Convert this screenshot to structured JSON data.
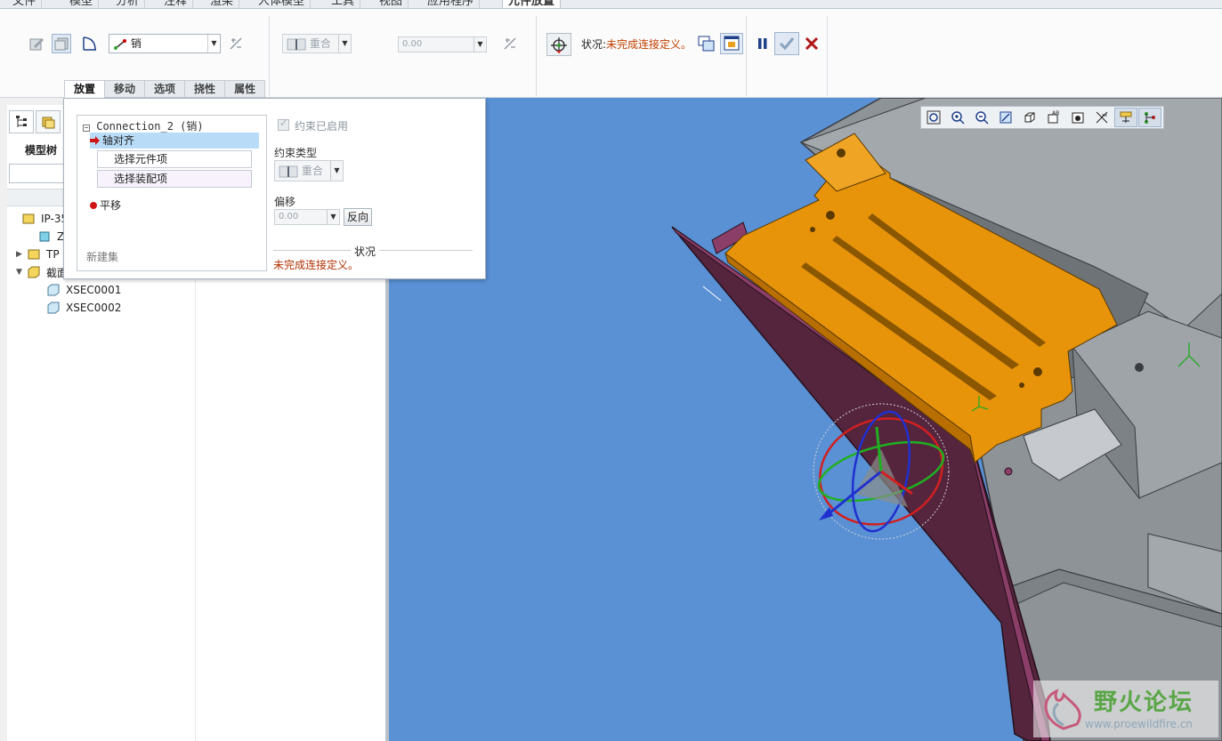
{
  "menubar": {
    "tabs": [
      "文件",
      "模型",
      "分析",
      "注释",
      "渲染",
      "人体模型",
      "工具",
      "视图",
      "应用程序",
      "元件放置"
    ],
    "active_tab": "元件放置"
  },
  "ribbon": {
    "connection_type": "销",
    "constraint_combo": "重合",
    "offset_value": "0.00",
    "status_prefix": "状况:",
    "status_text": "未完成连接定义。"
  },
  "subtabs": [
    "放置",
    "移动",
    "选项",
    "挠性",
    "属性"
  ],
  "active_subtab": "放置",
  "model_tree": {
    "title": "模型树",
    "items": [
      {
        "label": "IP-358",
        "level": 0,
        "expander": ""
      },
      {
        "label": "ZH",
        "level": 1,
        "expander": ""
      },
      {
        "label": "TP",
        "level": 1,
        "expander": "▶"
      },
      {
        "label": "截面",
        "level": 1,
        "expander": "▼"
      },
      {
        "label": "XSEC0001",
        "level": 2,
        "expander": ""
      },
      {
        "label": "XSEC0002",
        "level": 2,
        "expander": ""
      }
    ]
  },
  "placement_panel": {
    "connection_title": "Connection_2 (销)",
    "selected_item": "轴对齐",
    "sub_items": [
      "选择元件项",
      "选择装配项"
    ],
    "second_item": "平移",
    "new_set": "新建集",
    "constraint_enabled": "约束已启用",
    "constraint_type_label": "约束类型",
    "constraint_type": "重合",
    "offset_label": "偏移",
    "offset_value": "0.00",
    "flip_button": "反向",
    "status_label": "状况",
    "status_text": "未完成连接定义。"
  },
  "watermark": {
    "title": "野火论坛",
    "url": "www.proewildfire.cn"
  },
  "colors": {
    "viewport_bg": "#5a90d4",
    "part_orange": "#e8940a",
    "part_purple": "#55253e",
    "gray_body": "#8e9398"
  }
}
